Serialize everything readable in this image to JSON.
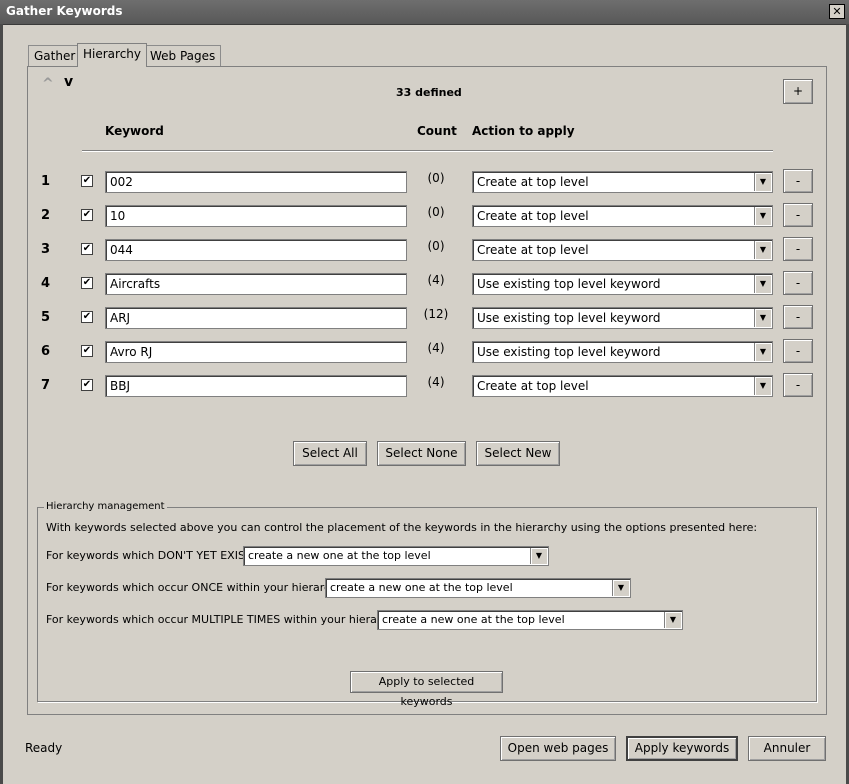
{
  "window": {
    "title": "Gather Keywords",
    "close_glyph": "✕"
  },
  "tabs": [
    {
      "label": "Gather",
      "active": false
    },
    {
      "label": "Hierarchy",
      "active": true
    },
    {
      "label": "Web Pages",
      "active": false
    }
  ],
  "toolbar": {
    "up_glyph": "^",
    "down_glyph": "v",
    "defined_count": "33 defined",
    "add_label": "+"
  },
  "table": {
    "headers": {
      "keyword": "Keyword",
      "count": "Count",
      "action": "Action to apply"
    },
    "rows": [
      {
        "num": "1",
        "checked": "✔",
        "keyword": "002",
        "count": "(0)",
        "action": "Create at top level",
        "remove": "-"
      },
      {
        "num": "2",
        "checked": "✔",
        "keyword": "10",
        "count": "(0)",
        "action": "Create at top level",
        "remove": "-"
      },
      {
        "num": "3",
        "checked": "✔",
        "keyword": "044",
        "count": "(0)",
        "action": "Create at top level",
        "remove": "-"
      },
      {
        "num": "4",
        "checked": "✔",
        "keyword": "Aircrafts",
        "count": "(4)",
        "action": "Use existing top level keyword",
        "remove": "-"
      },
      {
        "num": "5",
        "checked": "✔",
        "keyword": "ARJ",
        "count": "(12)",
        "action": "Use existing top level keyword",
        "remove": "-"
      },
      {
        "num": "6",
        "checked": "✔",
        "keyword": "Avro RJ",
        "count": "(4)",
        "action": "Use existing top level keyword",
        "remove": "-"
      },
      {
        "num": "7",
        "checked": "✔",
        "keyword": "BBJ",
        "count": "(4)",
        "action": "Create at top level",
        "remove": "-"
      }
    ]
  },
  "selection": {
    "select_all": "Select All",
    "select_none": "Select None",
    "select_new": "Select New"
  },
  "hierarchy": {
    "title": "Hierarchy management",
    "description": "With keywords selected above you can control the placement of the keywords in the hierarchy using the options presented here:",
    "not_exist_label": "For keywords which DON'T YET EXIST,",
    "not_exist_value": "create a new one at the top level",
    "once_label": "For keywords which occur ONCE within your hierarchy,",
    "once_value": "create a new one at the top level",
    "multiple_label": "For keywords which occur MULTIPLE TIMES within your hierarchy,",
    "multiple_value": "create a new one at the top level",
    "apply_selected": "Apply to selected keywords"
  },
  "footer": {
    "status": "Ready",
    "open_web_pages": "Open web pages",
    "apply_keywords": "Apply keywords",
    "cancel": "Annuler"
  },
  "icons": {
    "arrow": "▼"
  }
}
